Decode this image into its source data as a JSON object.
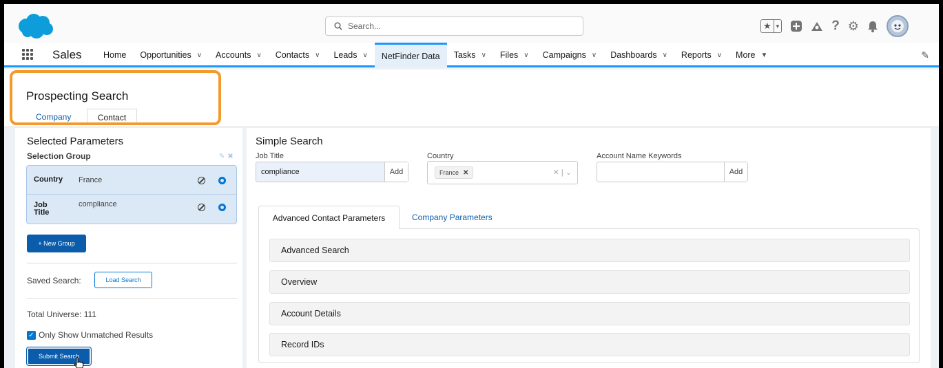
{
  "header": {
    "search_placeholder": "Search..."
  },
  "nav": {
    "app_name": "Sales",
    "items": [
      {
        "label": "Home",
        "dropdown": false
      },
      {
        "label": "Opportunities",
        "dropdown": true
      },
      {
        "label": "Accounts",
        "dropdown": true
      },
      {
        "label": "Contacts",
        "dropdown": true
      },
      {
        "label": "Leads",
        "dropdown": true
      },
      {
        "label": "NetFinder Data",
        "dropdown": false,
        "active": true
      },
      {
        "label": "Tasks",
        "dropdown": true
      },
      {
        "label": "Files",
        "dropdown": true
      },
      {
        "label": "Campaigns",
        "dropdown": true
      },
      {
        "label": "Dashboards",
        "dropdown": true
      },
      {
        "label": "Reports",
        "dropdown": true
      },
      {
        "label": "More",
        "dropdown": true
      }
    ]
  },
  "page": {
    "title": "Prospecting Search",
    "tabs": [
      "Company",
      "Contact"
    ]
  },
  "left": {
    "title": "Selected Parameters",
    "group_title": "Selection Group",
    "params": [
      {
        "label": "Country",
        "value": "France"
      },
      {
        "label": "Job Title",
        "value": "compliance"
      }
    ],
    "new_group": "+ New Group",
    "saved_search_label": "Saved Search:",
    "load_search": "Load Search",
    "total_universe": "Total Universe: 111",
    "unmatched_label": "Only Show Unmatched Results",
    "unmatched_checked": true,
    "submit": "Submit Search"
  },
  "right": {
    "title": "Simple Search",
    "job_title_label": "Job Title",
    "job_title_value": "compliance",
    "add": "Add",
    "country_label": "Country",
    "country_pill": "France",
    "account_label": "Account Name Keywords",
    "account_value": "",
    "tabs": [
      "Advanced Contact Parameters",
      "Company Parameters"
    ],
    "sections": [
      "Advanced Search",
      "Overview",
      "Account Details",
      "Record IDs"
    ]
  },
  "colors": {
    "brand_blue": "#0b5cab",
    "accent": "#1b96ff",
    "highlight": "#f39a2c"
  }
}
